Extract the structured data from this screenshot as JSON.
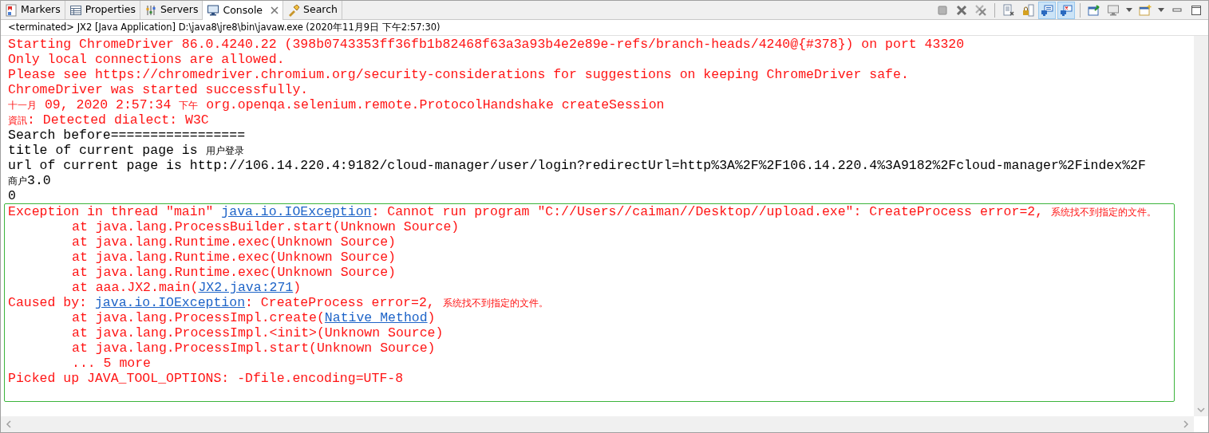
{
  "tabs": [
    {
      "label": "Markers",
      "selected": false,
      "closable": false
    },
    {
      "label": "Properties",
      "selected": false,
      "closable": false
    },
    {
      "label": "Servers",
      "selected": false,
      "closable": false
    },
    {
      "label": "Console",
      "selected": true,
      "closable": true
    },
    {
      "label": "Search",
      "selected": false,
      "closable": false
    }
  ],
  "toolbar": [
    {
      "kind": "button",
      "pressed": false
    },
    {
      "kind": "button",
      "pressed": false
    },
    {
      "kind": "button",
      "pressed": false
    },
    {
      "kind": "separator"
    },
    {
      "kind": "button",
      "pressed": false
    },
    {
      "kind": "button",
      "pressed": false
    },
    {
      "kind": "button",
      "pressed": true
    },
    {
      "kind": "button",
      "pressed": true
    },
    {
      "kind": "separator"
    },
    {
      "kind": "button",
      "pressed": false
    },
    {
      "kind": "dropdown",
      "pressed": false
    },
    {
      "kind": "dropdown",
      "pressed": false
    },
    {
      "kind": "window",
      "pressed": false
    },
    {
      "kind": "window",
      "pressed": false
    }
  ],
  "process_label": "<terminated> JX2 [Java Application] D:\\java8\\jre8\\bin\\javaw.exe (2020年11月9日 下午2:57:30)",
  "console": {
    "lines": [
      {
        "boxed": false,
        "indent": false,
        "segments": [
          {
            "kind": "err",
            "text": "Starting ChromeDriver 86.0.4240.22 (398b0743353ff36fb1b82468f63a3a93b4e2e89e-refs/branch-heads/4240@{#378}) on port 43320"
          }
        ]
      },
      {
        "boxed": false,
        "indent": false,
        "segments": [
          {
            "kind": "err",
            "text": "Only local connections are allowed."
          }
        ]
      },
      {
        "boxed": false,
        "indent": false,
        "segments": [
          {
            "kind": "err",
            "text": "Please see https://chromedriver.chromium.org/security-considerations for suggestions on keeping ChromeDriver safe."
          }
        ]
      },
      {
        "boxed": false,
        "indent": false,
        "segments": [
          {
            "kind": "err",
            "text": "ChromeDriver was started successfully."
          }
        ]
      },
      {
        "boxed": false,
        "indent": false,
        "segments": [
          {
            "kind": "err_cjk",
            "text": "十一月"
          },
          {
            "kind": "err",
            "text": " 09, 2020 2:57:34 "
          },
          {
            "kind": "err_cjk",
            "text": "下午"
          },
          {
            "kind": "err",
            "text": " org.openqa.selenium.remote.ProtocolHandshake createSession"
          }
        ]
      },
      {
        "boxed": false,
        "indent": false,
        "segments": [
          {
            "kind": "err_cjk",
            "text": "資訊"
          },
          {
            "kind": "err",
            "text": ": Detected dialect: W3C"
          }
        ]
      },
      {
        "boxed": false,
        "indent": false,
        "segments": [
          {
            "kind": "out",
            "text": "Search before================="
          }
        ]
      },
      {
        "boxed": false,
        "indent": false,
        "segments": [
          {
            "kind": "out",
            "text": "title of current page is "
          },
          {
            "kind": "out_cjk",
            "text": "用户登录"
          }
        ]
      },
      {
        "boxed": false,
        "indent": false,
        "segments": [
          {
            "kind": "out",
            "text": "url of current page is http://106.14.220.4:9182/cloud-manager/user/login?redirectUrl=http%3A%2F%2F106.14.220.4%3A9182%2Fcloud-manager%2Findex%2F"
          }
        ]
      },
      {
        "boxed": false,
        "indent": false,
        "segments": [
          {
            "kind": "out_cjk",
            "text": "商户"
          },
          {
            "kind": "out",
            "text": "3.0"
          }
        ]
      },
      {
        "boxed": false,
        "indent": false,
        "segments": [
          {
            "kind": "out",
            "text": "0"
          }
        ]
      },
      {
        "boxed": true,
        "indent": false,
        "segments": [
          {
            "kind": "err",
            "text": "Exception in thread \"main\" "
          },
          {
            "kind": "link",
            "text": "java.io.IOException"
          },
          {
            "kind": "err",
            "text": ": Cannot run program \"C://Users//caiman//Desktop//upload.exe\": CreateProcess error=2, "
          },
          {
            "kind": "err_cjk",
            "text": "系统找不到指定的文件。"
          }
        ]
      },
      {
        "boxed": true,
        "indent": true,
        "segments": [
          {
            "kind": "err",
            "text": "at java.lang.ProcessBuilder.start(Unknown Source)"
          }
        ]
      },
      {
        "boxed": true,
        "indent": true,
        "segments": [
          {
            "kind": "err",
            "text": "at java.lang.Runtime.exec(Unknown Source)"
          }
        ]
      },
      {
        "boxed": true,
        "indent": true,
        "segments": [
          {
            "kind": "err",
            "text": "at java.lang.Runtime.exec(Unknown Source)"
          }
        ]
      },
      {
        "boxed": true,
        "indent": true,
        "segments": [
          {
            "kind": "err",
            "text": "at java.lang.Runtime.exec(Unknown Source)"
          }
        ]
      },
      {
        "boxed": true,
        "indent": true,
        "segments": [
          {
            "kind": "err",
            "text": "at aaa.JX2.main("
          },
          {
            "kind": "link",
            "text": "JX2.java:271"
          },
          {
            "kind": "err",
            "text": ")"
          }
        ]
      },
      {
        "boxed": true,
        "indent": false,
        "segments": [
          {
            "kind": "err",
            "text": "Caused by: "
          },
          {
            "kind": "link",
            "text": "java.io.IOException"
          },
          {
            "kind": "err",
            "text": ": CreateProcess error=2, "
          },
          {
            "kind": "err_cjk",
            "text": "系统找不到指定的文件。"
          }
        ]
      },
      {
        "boxed": true,
        "indent": true,
        "segments": [
          {
            "kind": "err",
            "text": "at java.lang.ProcessImpl.create("
          },
          {
            "kind": "link",
            "text": "Native Method"
          },
          {
            "kind": "err",
            "text": ")"
          }
        ]
      },
      {
        "boxed": true,
        "indent": true,
        "segments": [
          {
            "kind": "err",
            "text": "at java.lang.ProcessImpl.<init>(Unknown Source)"
          }
        ]
      },
      {
        "boxed": true,
        "indent": true,
        "segments": [
          {
            "kind": "err",
            "text": "at java.lang.ProcessImpl.start(Unknown Source)"
          }
        ]
      },
      {
        "boxed": true,
        "indent": true,
        "segments": [
          {
            "kind": "err",
            "text": "... 5 more"
          }
        ]
      },
      {
        "boxed": true,
        "indent": false,
        "segments": [
          {
            "kind": "err",
            "text": "Picked up JAVA_TOOL_OPTIONS: -Dfile.encoding=UTF-8"
          }
        ]
      }
    ]
  }
}
